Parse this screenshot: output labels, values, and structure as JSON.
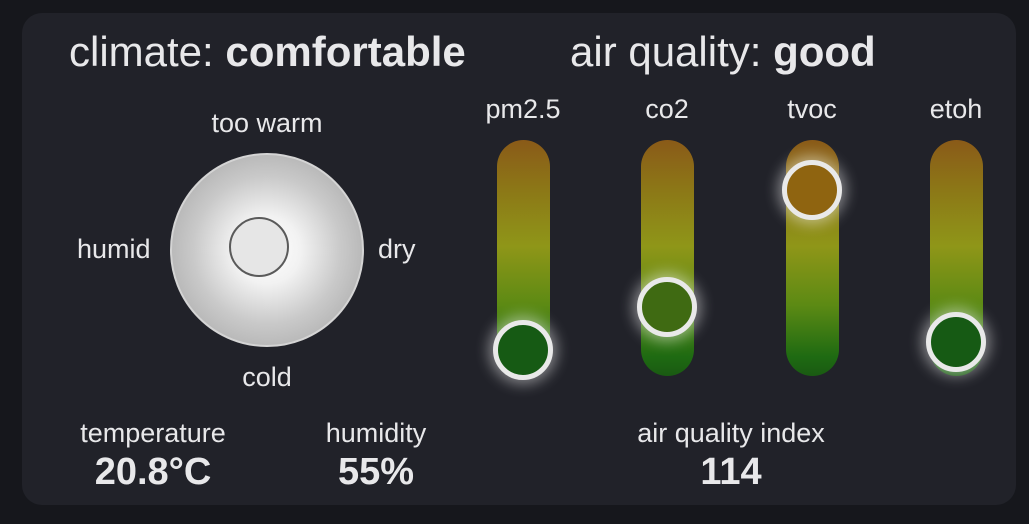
{
  "climate": {
    "prefix": "climate: ",
    "status": "comfortable",
    "labels": {
      "top": "too warm",
      "bottom": "cold",
      "left": "humid",
      "right": "dry"
    },
    "temperature": {
      "label": "temperature",
      "value": "20.8°C"
    },
    "humidity": {
      "label": "humidity",
      "value": "55%"
    }
  },
  "air_quality": {
    "prefix": "air quality: ",
    "status": "good",
    "index": {
      "label": "air quality index",
      "value": "114"
    },
    "sensors": [
      {
        "label": "pm2.5",
        "level": 0.06,
        "marker_color": "#165a14"
      },
      {
        "label": "co2",
        "level": 0.28,
        "marker_color": "#3f6a12"
      },
      {
        "label": "tvoc",
        "level": 0.88,
        "marker_color": "#8f6410"
      },
      {
        "label": "etoh",
        "level": 0.1,
        "marker_color": "#165a14"
      }
    ]
  },
  "colors": {
    "background": "#16171c",
    "card": "#212229",
    "text": "#e8e8ea"
  }
}
